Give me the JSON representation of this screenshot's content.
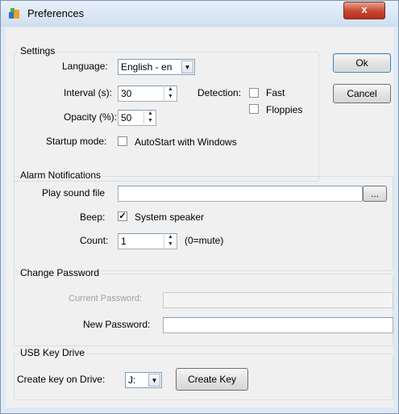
{
  "window": {
    "title": "Preferences",
    "close": "x"
  },
  "settings": {
    "legend": "Settings",
    "language_label": "Language:",
    "language_value": "English - en",
    "interval_label": "Interval (s):",
    "interval_value": "30",
    "detection_label": "Detection:",
    "fast_label": "Fast",
    "fast_checked": false,
    "floppies_label": "Floppies",
    "floppies_checked": false,
    "opacity_label": "Opacity (%):",
    "opacity_value": "50",
    "startup_label": "Startup mode:",
    "autostart_label": "AutoStart with Windows",
    "autostart_checked": false
  },
  "buttons": {
    "ok": "Ok",
    "cancel": "Cancel"
  },
  "alarm": {
    "legend": "Alarm Notifications",
    "play_sound_label": "Play sound file",
    "play_sound_value": "",
    "browse_label": "...",
    "beep_label": "Beep:",
    "system_speaker_label": "System speaker",
    "system_speaker_checked": true,
    "count_label": "Count:",
    "count_value": "1",
    "count_hint": "(0=mute)"
  },
  "password": {
    "legend": "Change Password",
    "current_label": "Current Password:",
    "current_value": "",
    "new_label": "New Password:",
    "new_value": ""
  },
  "usb": {
    "legend": "USB Key Drive",
    "create_on_label": "Create key on Drive:",
    "drive_value": "J:",
    "create_key_label": "Create Key"
  }
}
